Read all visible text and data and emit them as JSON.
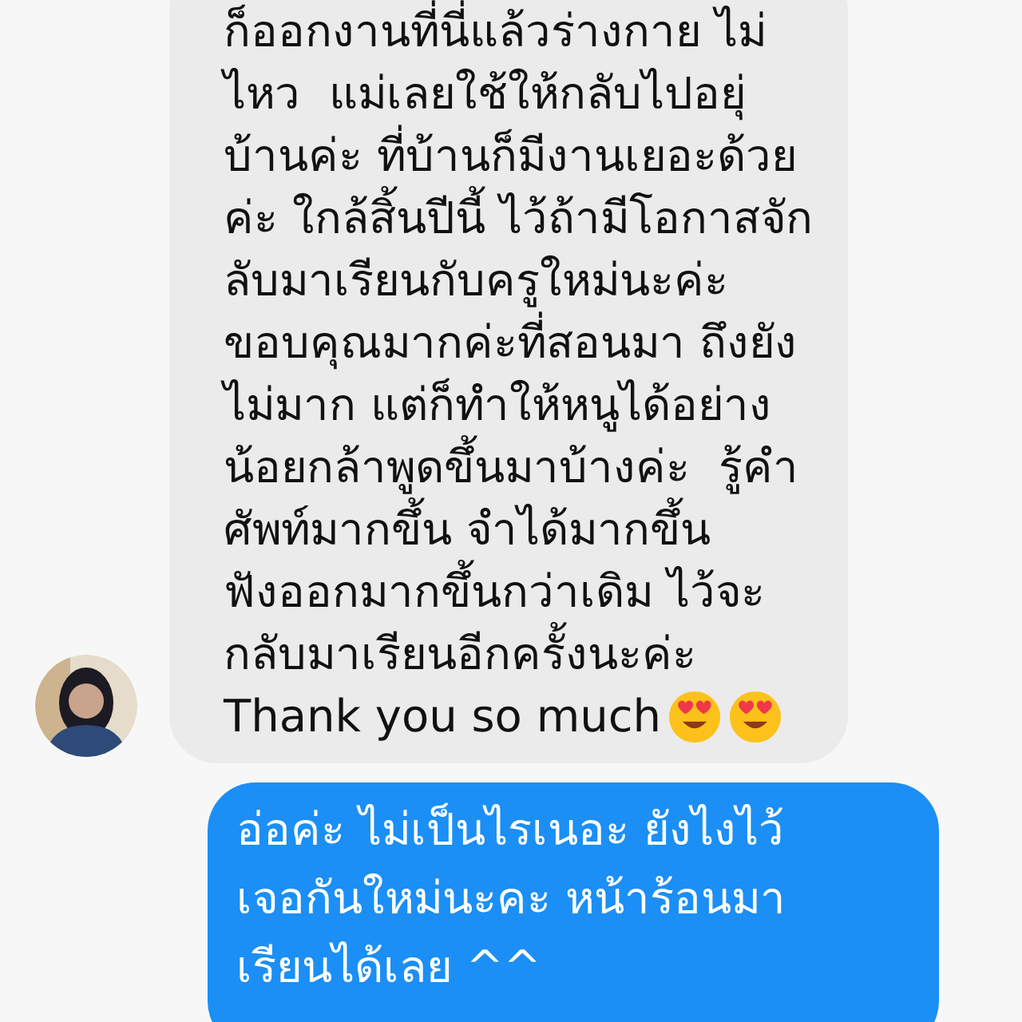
{
  "messages": [
    {
      "kind": "received",
      "text": "ก็ออกงานที่นี่แล้วร่างกาย ไม่\nไหว  แม่เลยใช้ให้กลับไปอยุ่\nบ้านค่ะ ที่บ้านก็มีงานเยอะด้วย\nค่ะ ใกล้สิ้นปีนี้ ไว้ถ้ามีโอกาสจัก\nลับมาเรียนกับครูใหม่นะค่ะ\nขอบคุณมากค่ะที่สอนมา ถึงยัง\nไม่มาก แต่ก็ทำให้หนูได้อย่าง\nน้อยกล้าพูดขึ้นมาบ้างค่ะ  รู้คำ\nศัพท์มากขึ้น จำได้มากขึ้น\nฟังออกมากขึ้นกว่าเดิม ไว้จะ\nกลับมาเรียนอีกครั้งนะค่ะ",
      "closing": "Thank you so much"
    },
    {
      "kind": "sent",
      "text": "อ่อค่ะ ไม่เป็นไรเนอะ ยังไงไว้\nเจอกันใหม่นะคะ หน้าร้อนมา\nเรียนได้เลย ^^"
    }
  ]
}
